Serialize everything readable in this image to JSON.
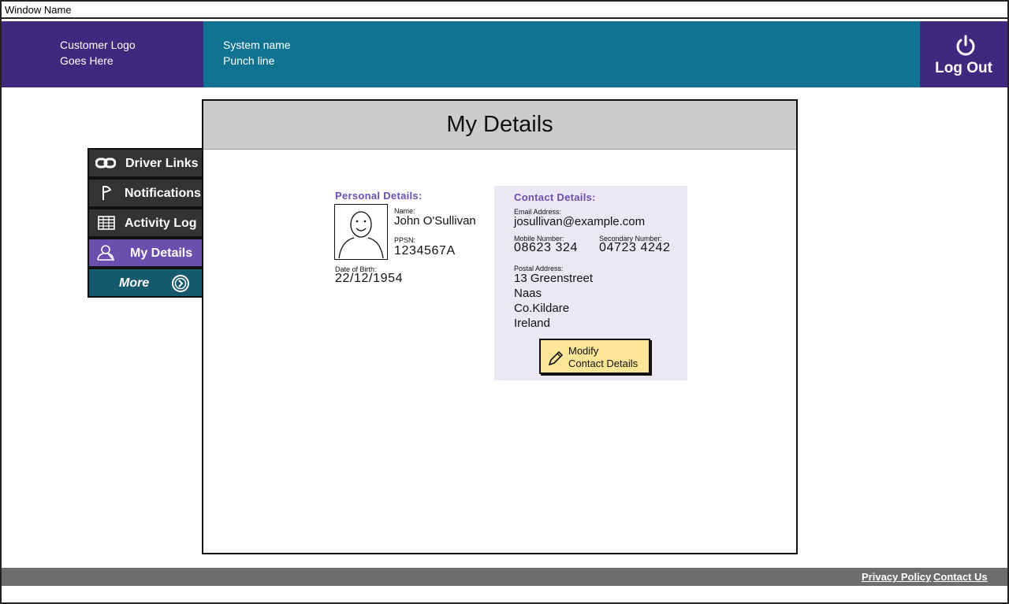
{
  "window": {
    "title": "Window Name"
  },
  "header": {
    "logo_line1": "Customer  Logo",
    "logo_line2": "Goes Here",
    "system_name": "System name",
    "punch_line": "Punch line",
    "logout_label": "Log Out",
    "colors": {
      "logo_bg": "#3d2a7e",
      "system_bg": "#107391"
    }
  },
  "sidebar": {
    "items": [
      {
        "label": "Driver Links",
        "icon": "link-icon",
        "active": false
      },
      {
        "label": "Notifications",
        "icon": "flag-icon",
        "active": false
      },
      {
        "label": "Activity Log",
        "icon": "table-icon",
        "active": false
      },
      {
        "label": "My Details",
        "icon": "user-icon",
        "active": true
      },
      {
        "label": "More",
        "icon": "chevron-right-circle-icon",
        "active": false
      }
    ],
    "colors": {
      "default_bg": "#333333",
      "active_bg": "#6a4fae",
      "more_bg": "#165a6e"
    }
  },
  "page": {
    "title": "My Details"
  },
  "personal": {
    "title": "Personal Details:",
    "name_label": "Name:",
    "name": "John O'Sullivan",
    "ppsn_label": "PPSN:",
    "ppsn": "1234567A",
    "dob_label": "Date of Birth:",
    "dob": "22/12/1954"
  },
  "contact": {
    "title": "Contact Details:",
    "email_label": "Email Address:",
    "email": "josullivan@example.com",
    "mobile_label": "Mobile Number:",
    "mobile": "08623 324",
    "secondary_label": "Secondary Number:",
    "secondary": "04723 4242",
    "postal_label": "Postal Address:",
    "address": [
      "13 Greenstreet",
      "Naas",
      "Co.Kildare",
      "Ireland"
    ],
    "modify_line1": "Modify",
    "modify_line2": "Contact Details",
    "colors": {
      "box_bg": "#ebe7f5",
      "button_bg": "#fde597",
      "heading": "#6a4fae"
    }
  },
  "footer": {
    "privacy": "Privacy Policy",
    "contact": "Contact Us"
  }
}
